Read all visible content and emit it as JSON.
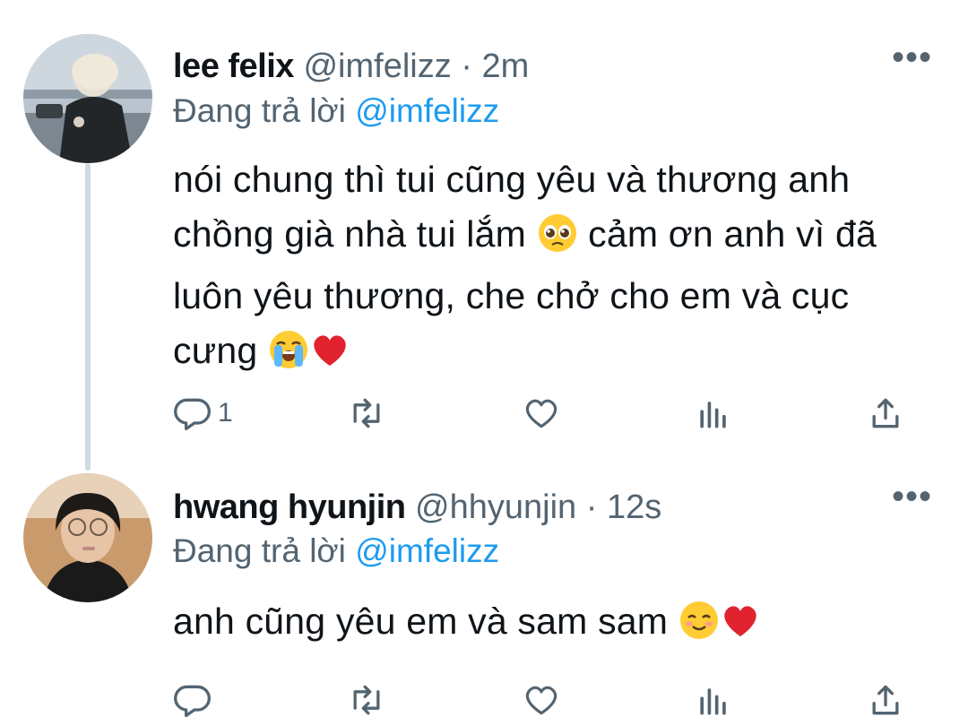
{
  "tweets": [
    {
      "name": "lee felix",
      "handle": "@imfelizz",
      "separator": "·",
      "time": "2m",
      "reply_prefix": "Đang trả lời",
      "reply_to": "@imfelizz",
      "text_lines": [
        "nói chung thì tui cũng yêu và thương anh",
        "chồng già nhà tui lắm",
        "cảm ơn anh vì đã",
        "luôn yêu thương, che chở cho em và cục",
        "cưng"
      ],
      "emojis": [
        "pleading-face",
        "loudly-crying-face",
        "red-heart"
      ],
      "reply_count": "1",
      "more_label": "•••"
    },
    {
      "name": "hwang hyunjin",
      "handle": "@hhyunjin",
      "separator": "·",
      "time": "12s",
      "reply_prefix": "Đang trả lời",
      "reply_to": "@imfelizz",
      "text_lines": [
        "anh cũng yêu em và sam sam"
      ],
      "emojis": [
        "smiling-face",
        "red-heart"
      ],
      "reply_count": "",
      "more_label": "•••"
    }
  ],
  "colors": {
    "accent": "#1d9bf0",
    "secondary": "#536471",
    "thread_line": "#cfd9de",
    "text": "#0f1419"
  },
  "icons": [
    "reply-icon",
    "retweet-icon",
    "like-icon",
    "views-icon",
    "share-icon",
    "more-icon"
  ]
}
